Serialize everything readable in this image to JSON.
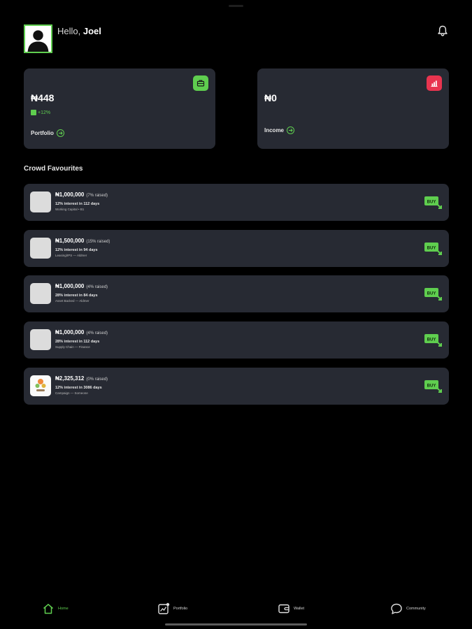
{
  "header": {
    "greeting": "Hello,",
    "user_name": "Joel"
  },
  "cards": {
    "portfolio": {
      "amount": "₦448",
      "change": "+12%",
      "link_label": "Portfolio",
      "icon": "briefcase-icon",
      "accent": "#5fce4f"
    },
    "income": {
      "amount": "₦0",
      "link_label": "Income",
      "icon": "chart-icon",
      "accent": "#e8344f"
    }
  },
  "section_title": "Crowd Favourites",
  "deals": [
    {
      "amount": "₦1,000,000",
      "raised": "(7% raised)",
      "interest": "12% interest in 112 days",
      "category": "Working Capital • B1",
      "thumb": "placeholder"
    },
    {
      "amount": "₦1,500,000",
      "raised": "(15% raised)",
      "interest": "12% interest in 94 days",
      "category": "Leasing/IPS — Aldmer",
      "thumb": "placeholder"
    },
    {
      "amount": "₦1,000,000",
      "raised": "(4% raised)",
      "interest": "28% interest in 84 days",
      "category": "Asset Backed — Aldmer",
      "thumb": "placeholder"
    },
    {
      "amount": "₦1,000,000",
      "raised": "(4% raised)",
      "interest": "28% interest in 112 days",
      "category": "Supply Chain — Finance",
      "thumb": "placeholder"
    },
    {
      "amount": "₦2,325,312",
      "raised": "(0% raised)",
      "interest": "12% interest in 3086 days",
      "category": "Campaign — Someone",
      "thumb": "logo"
    }
  ],
  "buy_label": "BUY",
  "nav": {
    "home": "Home",
    "portfolio": "Portfolio",
    "wallet": "Wallet",
    "community": "Community"
  },
  "colors": {
    "background": "#000000",
    "card": "#272a33",
    "accent_green": "#5fce4f",
    "accent_red": "#e8344f"
  }
}
